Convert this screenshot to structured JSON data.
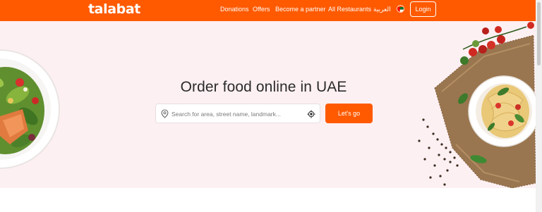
{
  "brand": {
    "logo": "talabat",
    "color": "#ff5a00"
  },
  "nav": {
    "links": [
      "Donations",
      "Offers",
      "Become a partner",
      "All Restaurants",
      "العربية"
    ],
    "flag_icon": "uae-flag-icon",
    "login_label": "Login"
  },
  "hero": {
    "headline": "Order food online in UAE",
    "background": "#fdf0f2"
  },
  "search": {
    "placeholder": "Search for area, street name, landmark...",
    "value": "",
    "location_pin_icon": "location-pin-icon",
    "locate_icon": "locate-me-icon",
    "submit_label": "Let's go"
  }
}
